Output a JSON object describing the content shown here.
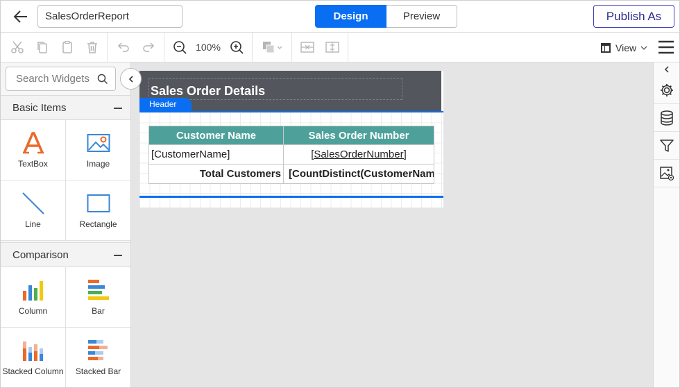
{
  "header": {
    "report_name": "SalesOrderReport",
    "design_label": "Design",
    "preview_label": "Preview",
    "publish_label": "Publish As"
  },
  "toolbar": {
    "zoom": "100%",
    "view_label": "View"
  },
  "left_panel": {
    "search_placeholder": "Search Widgets",
    "sections": [
      {
        "title": "Basic Items",
        "items": [
          "TextBox",
          "Image",
          "Line",
          "Rectangle"
        ]
      },
      {
        "title": "Comparison",
        "items": [
          "Column",
          "Bar",
          "Stacked Column",
          "Stacked Bar"
        ]
      }
    ]
  },
  "report": {
    "title": "Sales Order Details",
    "header_tag": "Header",
    "table": {
      "headers": [
        "Customer Name",
        "Sales Order Number"
      ],
      "row1": [
        "[CustomerName]",
        "[SalesOrderNumber]"
      ],
      "row2": [
        "Total Customers",
        "[CountDistinct(CustomerName)]"
      ]
    }
  },
  "colors": {
    "accent": "#0a6ef3",
    "header_bg": "#53575d",
    "table_header": "#4ea19a",
    "publish_border": "#3f3fb0"
  },
  "icons": {
    "toolbar": [
      "cut-icon",
      "copy-icon",
      "paste-icon",
      "delete-icon",
      "undo-icon",
      "redo-icon",
      "zoom-out-icon",
      "zoom-in-icon",
      "fill-color-icon",
      "align-middle-icon",
      "align-center-icon",
      "view-layout-icon",
      "menu-icon"
    ],
    "right_panel": [
      "collapse-left-icon",
      "settings-icon",
      "data-source-icon",
      "filter-icon",
      "image-manager-icon"
    ]
  }
}
